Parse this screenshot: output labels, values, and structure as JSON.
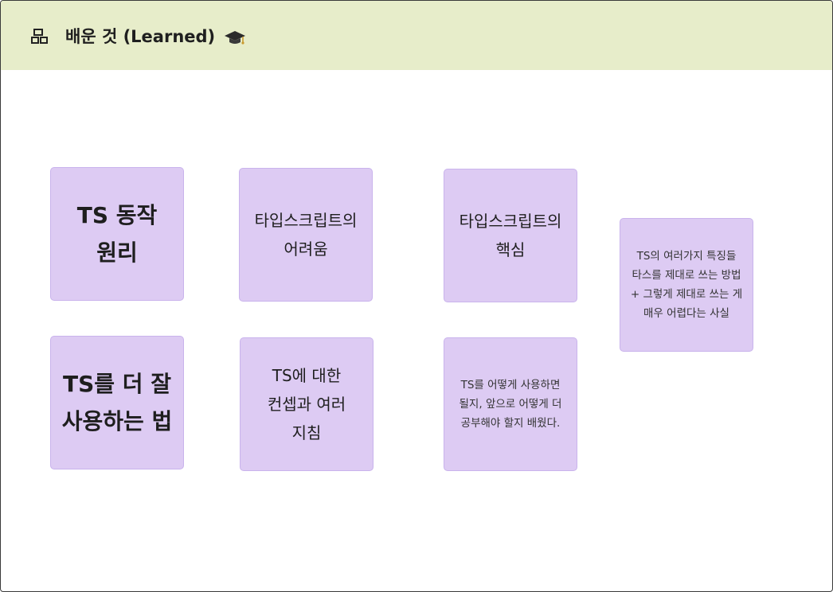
{
  "header": {
    "icon": "panel-icon",
    "title": "배운 것 (Learned)",
    "title_icon": "graduation-cap-icon"
  },
  "notes": [
    {
      "text": "TS 동작\n원리"
    },
    {
      "text": "타입스크립트의\n어려움"
    },
    {
      "text": "타입스크립트의\n핵심"
    },
    {
      "text": "TS의 여러가지 특징들\n타스를 제대로 쓰는 방법\n+ 그렇게 제대로 쓰는 게\n매우 어렵다는 사실"
    },
    {
      "text": "TS를 더 잘\n사용하는 법"
    },
    {
      "text": "TS에 대한\n컨셉과 여러\n지침"
    },
    {
      "text": "  TS를 어떻게 사용하면\n될지, 앞으로 어떻게 더\n공부해야 할지 배웠다."
    }
  ],
  "colors": {
    "header_bg": "#e7edca",
    "sticky_bg": "#ddcbf3"
  }
}
